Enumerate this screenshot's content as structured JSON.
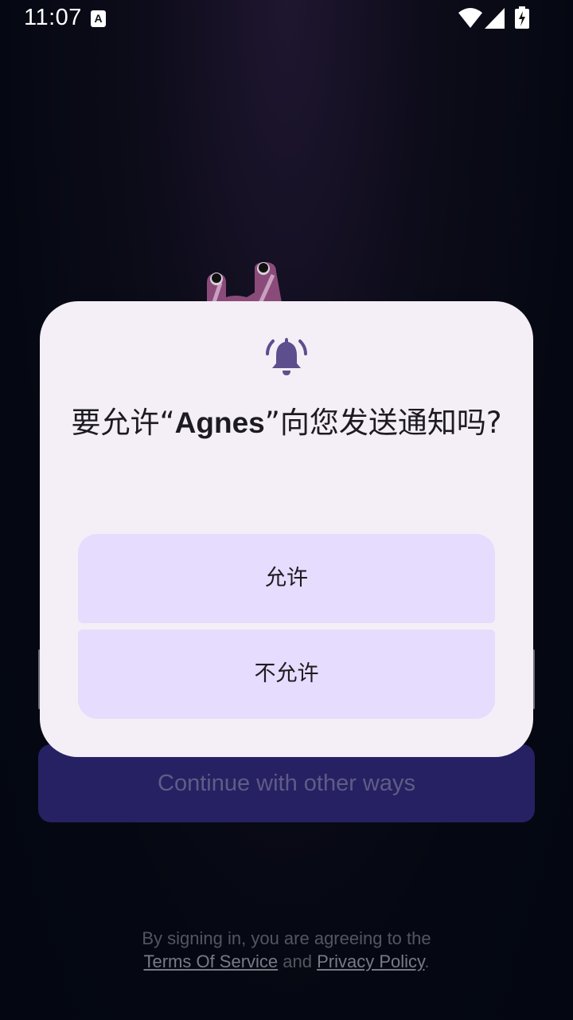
{
  "status_bar": {
    "time": "11:07",
    "notification_icon": "a-letter-icon",
    "notification_letter": "A",
    "icons": [
      "wifi-icon",
      "cell-signal-icon",
      "battery-charging-icon"
    ]
  },
  "background": {
    "continue_button_label": "Continue with other ways",
    "legal": {
      "line1": "By signing in, you are agreeing to the",
      "terms_link": "Terms Of Service",
      "and_text": "and",
      "privacy_link": "Privacy Policy",
      "period": "."
    }
  },
  "dialog": {
    "icon": "notification-bell-icon",
    "title_prefix": "要允许“",
    "app_name": "Agnes",
    "title_suffix": "”向您发送通知吗?",
    "allow_label": "允许",
    "deny_label": "不允许"
  },
  "colors": {
    "dialog_background": "#f4eff6",
    "dialog_button": "#e6dcfd",
    "accent_icon": "#5d4e8e",
    "continue_button": "#262163",
    "page_background": "#050812"
  }
}
